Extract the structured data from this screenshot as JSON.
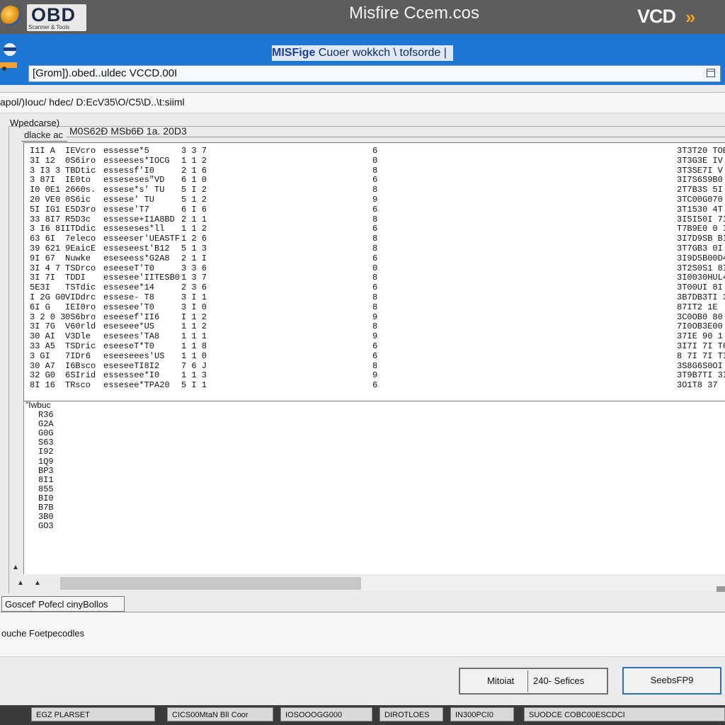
{
  "topbar": {
    "logo_text": "OBD",
    "logo_subtitle": "Scanner & Tools",
    "app_title": "Misfire Ccem.cos",
    "brand": "VCD",
    "brand_mark": "»"
  },
  "header": {
    "title_bold": "MISFige",
    "title_rest": " Cuoer wokkch \\ tofsorde |",
    "path_value": "[Grom]).obed..uldec VCCD.00I"
  },
  "subpath": {
    "text": "apol/)Iouc/ hdec/ D:EcV35\\O/C5\\D..\\t:siiml"
  },
  "panel": {
    "group_label": "Wpedcarse)",
    "tab_label": "dlacke ac",
    "header_caption": "M0S62Ð MSb6Ð 1a. 20D3"
  },
  "table": {
    "rows": [
      [
        "I1I  A",
        "IEVcro",
        "essesse*5",
        "3 3  7",
        "6",
        "3T3T20 TOB"
      ],
      [
        "3I  12",
        "0S6iro",
        "esseeses*IOCG",
        "1  1  2",
        "0",
        "3T3G3E IV"
      ],
      [
        "3  I3 3",
        "TBDtic",
        "essessf'I0",
        "2  1  6",
        "8",
        "3T3SE7I V"
      ],
      [
        "3  87I",
        "IE0to",
        "esseseses\"VD",
        "6  1  0",
        "6",
        "3I7S6S9B0"
      ],
      [
        "I0 0E1",
        "2660s.",
        "essese*s' TU",
        "5  I  2",
        "8",
        "2T7B3S  5I"
      ],
      [
        "20 VE0",
        "0S6ic",
        "essese'  TU",
        "5  1  2",
        "9",
        "3TC00G070"
      ],
      [
        "5I IG1",
        "E5D3ro",
        "essese'T7",
        "6  I  6",
        "6",
        "3T1530  4T"
      ],
      [
        "33 8I7",
        "R5D3c",
        "essesse+I1A8BD",
        "2  1  1",
        "8",
        "3I5I50I  7I"
      ],
      [
        "3 I6  8I",
        "ITDdic",
        "esseseses*ll",
        "1  1  2",
        "6",
        "T7B9E0 0 I"
      ],
      [
        "63 6I",
        "7eleco",
        "esseeser'UEASTF",
        "1  2  6",
        "8",
        "3I7D9SB  BI"
      ],
      [
        "39 621",
        "9EaicE",
        "esseseest'B12",
        "5  1  3",
        "8",
        "3T7GB3 0I"
      ],
      [
        "9I 67",
        "Nuwke",
        "eseseess*G2A8",
        "2  1  I",
        "6",
        "3I9D5B00D4"
      ],
      [
        "3I  4 7",
        "TSDrco",
        "eseeseT'T0",
        "3  3  6",
        "0",
        "3T2S0S1  8I"
      ],
      [
        "3I  7I",
        "TDDI",
        "essesee'IITESB0",
        "1  3  7",
        "8",
        "3I0030HUL44"
      ],
      [
        "5E3I",
        "TSTdic",
        "essesee*14",
        "2  3  6",
        "6",
        "3T00UI  8I"
      ],
      [
        "I 2G G0",
        "VIDdrc",
        "essese-  T8",
        "3  I  1",
        "8",
        "3B7DB3TI  3"
      ],
      [
        "6I  G",
        "IEI0ro",
        "essesee'T0",
        "3  I  0",
        "8",
        "87IT2  1E"
      ],
      [
        "3 2 0 3",
        "0S6bro",
        "eseesef'II6",
        "I  1  2",
        "9",
        "3C0OB0  80"
      ],
      [
        "3I 7G",
        "V60rld",
        "eseseee*US",
        "1  1  2",
        "8",
        "7I0OB3E00"
      ],
      [
        "30 AI",
        "V3Dle",
        "esesees'TA8",
        "1  1  1",
        "9",
        "37IE  90  1"
      ],
      [
        "33 A5",
        "TSDric",
        "eseeseT*T0",
        "1  1  8",
        "6",
        "3I7I  7I  T6"
      ],
      [
        "3  GI",
        "7IDr6",
        "eseeseees'US",
        "1  1  0",
        "6",
        "8  7I  7I  TI"
      ],
      [
        "30 A7",
        "I6Bsco",
        "eseseeTI8I2",
        "7  6  J",
        "8",
        "3S8G6S0OI"
      ],
      [
        "32 G0",
        "6SIrid",
        "essessee*I0",
        "1  1  3",
        "9",
        "3T9B7TI  3I"
      ],
      [
        "8I 16",
        "TRsco",
        "essesee*TPA20",
        "5  I  1",
        "6",
        "3O1T8  37"
      ]
    ]
  },
  "list": {
    "caption": "\"Iwbuc",
    "items": [
      "R36",
      "G2A",
      "G0G",
      "S63",
      "I92",
      "1Q9",
      "BP3",
      "8I1",
      "855",
      "BI0",
      "B7B",
      "3B0",
      "GO3"
    ]
  },
  "bottom": {
    "tab_label": "Goscef' Pofecl cinyBollos",
    "status_text": "ouche Foetpecodles",
    "button1_left": "Mitoiat",
    "button1_right": "240- Sefices",
    "button2": "SeebsFP9"
  },
  "taskbar": {
    "items": [
      "EGZ PLARSET",
      "CICS00MtaN BlI Coor",
      "IOSOOOGG000",
      "DIROTLOES",
      "IN300PCI0",
      "SUODCE COBC00ESCDCI"
    ]
  }
}
